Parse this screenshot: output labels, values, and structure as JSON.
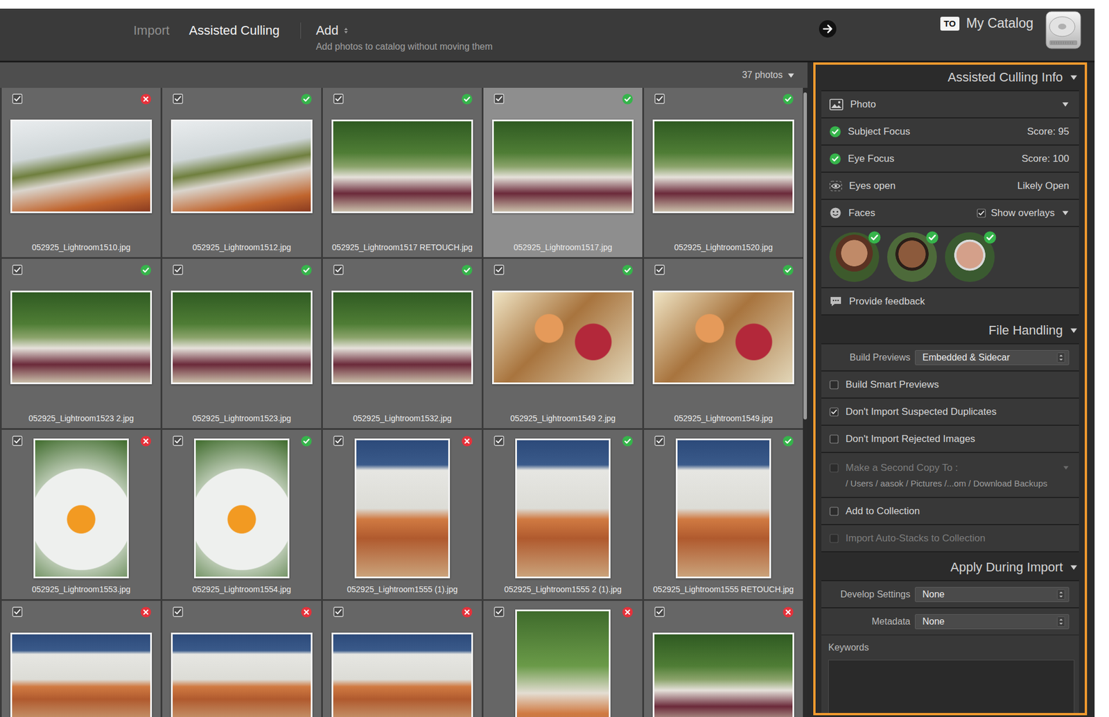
{
  "topbar": {
    "tabs": [
      {
        "label": "Import",
        "selected": false
      },
      {
        "label": "Assisted Culling",
        "selected": true
      }
    ],
    "mode": {
      "label": "Add",
      "description": "Add photos to catalog without moving them"
    },
    "destination": {
      "badge": "TO",
      "label": "My Catalog"
    }
  },
  "grid": {
    "count": "37 photos",
    "scrollbar": {
      "level": 0.52
    },
    "photos": [
      {
        "filename": "052925_Lightroom1510.jpg",
        "included": true,
        "accepted": false,
        "selected": false,
        "kind": "landscape"
      },
      {
        "filename": "052925_Lightroom1512.jpg",
        "included": true,
        "accepted": true,
        "selected": false,
        "kind": "landscape"
      },
      {
        "filename": "052925_Lightroom1517 RETOUCH.jpg",
        "included": true,
        "accepted": true,
        "selected": false,
        "kind": "landscape"
      },
      {
        "filename": "052925_Lightroom1517.jpg",
        "included": true,
        "accepted": true,
        "selected": true,
        "kind": "landscape"
      },
      {
        "filename": "052925_Lightroom1520.jpg",
        "included": true,
        "accepted": true,
        "selected": false,
        "kind": "landscape"
      },
      {
        "filename": "052925_Lightroom1523 2.jpg",
        "included": true,
        "accepted": true,
        "selected": false,
        "kind": "landscape"
      },
      {
        "filename": "052925_Lightroom1523.jpg",
        "included": true,
        "accepted": true,
        "selected": false,
        "kind": "landscape"
      },
      {
        "filename": "052925_Lightroom1532.jpg",
        "included": true,
        "accepted": true,
        "selected": false,
        "kind": "landscape"
      },
      {
        "filename": "052925_Lightroom1549 2.jpg",
        "included": true,
        "accepted": true,
        "selected": false,
        "kind": "landscape"
      },
      {
        "filename": "052925_Lightroom1549.jpg",
        "included": true,
        "accepted": true,
        "selected": false,
        "kind": "landscape"
      },
      {
        "filename": "052925_Lightroom1553.jpg",
        "included": true,
        "accepted": false,
        "selected": false,
        "kind": "portrait"
      },
      {
        "filename": "052925_Lightroom1554.jpg",
        "included": true,
        "accepted": true,
        "selected": false,
        "kind": "portrait"
      },
      {
        "filename": "052925_Lightroom1555 (1).jpg",
        "included": true,
        "accepted": false,
        "selected": false,
        "kind": "portrait"
      },
      {
        "filename": "052925_Lightroom1555 2 (1).jpg",
        "included": true,
        "accepted": true,
        "selected": false,
        "kind": "portrait"
      },
      {
        "filename": "052925_Lightroom1555 RETOUCH.jpg",
        "included": true,
        "accepted": true,
        "selected": false,
        "kind": "portrait"
      },
      {
        "included": true,
        "accepted": false,
        "selected": false,
        "kind": "landscape"
      },
      {
        "included": true,
        "accepted": false,
        "selected": false,
        "kind": "landscape"
      },
      {
        "included": true,
        "accepted": false,
        "selected": false,
        "kind": "landscape"
      },
      {
        "included": true,
        "accepted": false,
        "selected": false,
        "kind": "portrait"
      },
      {
        "included": true,
        "accepted": false,
        "selected": false,
        "kind": "landscape"
      }
    ]
  },
  "panel": {
    "culling_info": {
      "title": "Assisted Culling Info",
      "expanded": true,
      "photo": {
        "label": "Photo",
        "expanded": true
      },
      "metrics": [
        {
          "label": "Subject Focus",
          "value": "Score: 95",
          "kind": "check"
        },
        {
          "label": "Eye Focus",
          "value": "Score: 100",
          "kind": "check"
        },
        {
          "label": "Eyes open",
          "value": "Likely Open",
          "kind": "eye"
        }
      ],
      "faces": {
        "label": "Faces",
        "expanded": true,
        "overlays": {
          "label": "Show overlays",
          "checked": true
        },
        "people": [
          {
            "approved": true
          },
          {
            "approved": true
          },
          {
            "approved": true
          }
        ]
      },
      "feedback": "Provide feedback"
    },
    "file_handling": {
      "title": "File Handling",
      "expanded": true,
      "build_previews": {
        "label": "Build Previews",
        "value": "Embedded & Sidecar"
      },
      "options": [
        {
          "label": "Build Smart Previews",
          "checked": false,
          "disabled": false
        },
        {
          "label": "Don't Import Suspected Duplicates",
          "checked": true,
          "disabled": false
        },
        {
          "label": "Don't Import Rejected Images",
          "checked": false,
          "disabled": false
        },
        {
          "label": "Make a Second Copy To :",
          "checked": false,
          "disabled": true,
          "path": "/ Users / aasok / Pictures /...om / Download Backups"
        },
        {
          "label": "Add to Collection",
          "checked": false,
          "disabled": false
        },
        {
          "label": "Import Auto-Stacks to Collection",
          "checked": false,
          "disabled": true
        }
      ]
    },
    "apply": {
      "title": "Apply During Import",
      "expanded": true,
      "fields": [
        {
          "label": "Develop Settings",
          "value": "None"
        },
        {
          "label": "Metadata",
          "value": "None"
        }
      ],
      "keywords": {
        "label": "Keywords"
      }
    }
  }
}
